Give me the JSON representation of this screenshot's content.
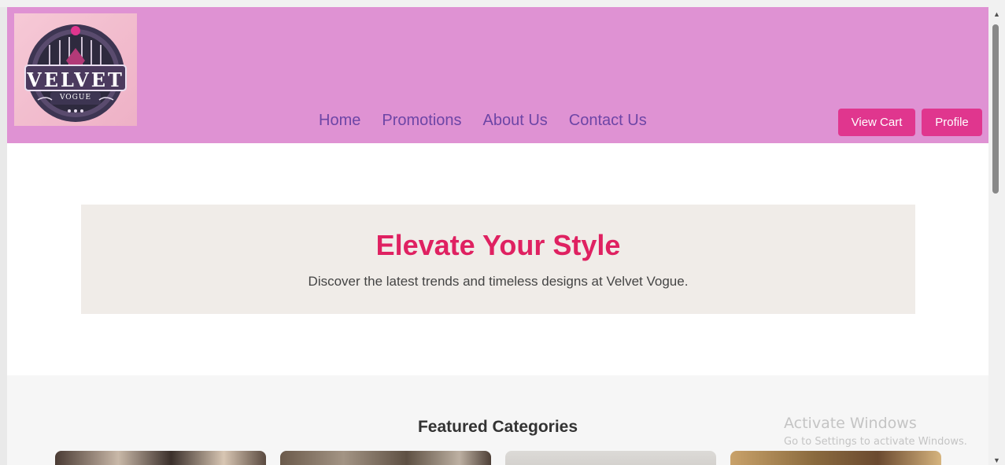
{
  "brand": {
    "logo_text": "VELVET",
    "logo_subtext": "VOGUE",
    "accent_color": "#e0368e",
    "header_color": "#df92d3"
  },
  "nav": {
    "items": [
      {
        "label": "Home"
      },
      {
        "label": "Promotions"
      },
      {
        "label": "About Us"
      },
      {
        "label": "Contact Us"
      }
    ]
  },
  "header_buttons": {
    "view_cart": "View Cart",
    "profile": "Profile"
  },
  "hero": {
    "title": "Elevate Your Style",
    "subtitle": "Discover the latest trends and timeless designs at Velvet Vogue."
  },
  "featured": {
    "title": "Featured Categories"
  },
  "watermark": {
    "line1": "Activate Windows",
    "line2": "Go to Settings to activate Windows."
  },
  "icons": {
    "scroll_up": "scroll-up-arrow-icon",
    "scroll_down": "scroll-down-arrow-icon"
  }
}
